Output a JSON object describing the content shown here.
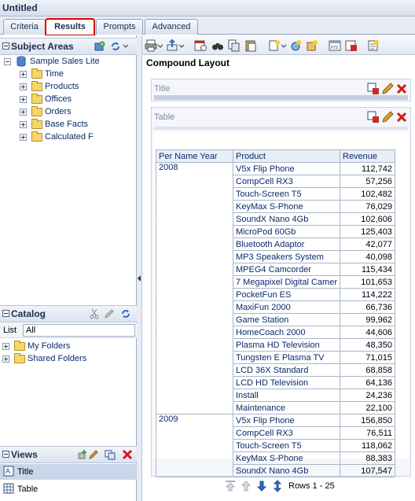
{
  "window": {
    "title": "Untitled"
  },
  "tabs": [
    {
      "label": "Criteria"
    },
    {
      "label": "Results"
    },
    {
      "label": "Prompts"
    },
    {
      "label": "Advanced"
    }
  ],
  "subject_areas": {
    "title": "Subject Areas",
    "root": "Sample Sales Lite",
    "items": [
      "Time",
      "Products",
      "Offices",
      "Orders",
      "Base Facts",
      "Calculated F"
    ]
  },
  "catalog": {
    "title": "Catalog",
    "list_label": "List",
    "list_value": "All",
    "items": [
      "My Folders",
      "Shared Folders"
    ]
  },
  "views": {
    "title": "Views",
    "items": [
      "Title",
      "Table"
    ]
  },
  "layout": {
    "heading": "Compound Layout",
    "title_view_label": "Title",
    "table_view_label": "Table"
  },
  "table": {
    "headers": [
      "Per Name Year",
      "Product",
      "Revenue"
    ],
    "groups": [
      {
        "year": "2008",
        "rows": [
          [
            "V5x Flip Phone",
            "112,742"
          ],
          [
            "CompCell RX3",
            "57,256"
          ],
          [
            "Touch-Screen T5",
            "102,482"
          ],
          [
            "KeyMax S-Phone",
            "76,029"
          ],
          [
            "SoundX Nano 4Gb",
            "102,606"
          ],
          [
            "MicroPod 60Gb",
            "125,403"
          ],
          [
            "Bluetooth Adaptor",
            "42,077"
          ],
          [
            "MP3 Speakers System",
            "40,098"
          ],
          [
            "MPEG4 Camcorder",
            "115,434"
          ],
          [
            "7 Megapixel Digital Camer",
            "101,653"
          ],
          [
            "PocketFun ES",
            "114,222"
          ],
          [
            "MaxiFun 2000",
            "66,736"
          ],
          [
            "Game Station",
            "99,962"
          ],
          [
            "HomeCoach 2000",
            "44,606"
          ],
          [
            "Plasma HD Television",
            "48,350"
          ],
          [
            "Tungsten E Plasma TV",
            "71,015"
          ],
          [
            "LCD 36X Standard",
            "68,858"
          ],
          [
            "LCD HD Television",
            "64,136"
          ],
          [
            "Install",
            "24,236"
          ],
          [
            "Maintenance",
            "22,100"
          ]
        ]
      },
      {
        "year": "2009",
        "rows": [
          [
            "V5x Flip Phone",
            "156,850"
          ],
          [
            "CompCell RX3",
            "76,511"
          ],
          [
            "Touch-Screen T5",
            "118,062"
          ],
          [
            "KeyMax S-Phone",
            "88,383"
          ],
          [
            "SoundX Nano 4Gb",
            "107,547"
          ]
        ]
      }
    ],
    "pager_text": "Rows 1 - 25"
  }
}
